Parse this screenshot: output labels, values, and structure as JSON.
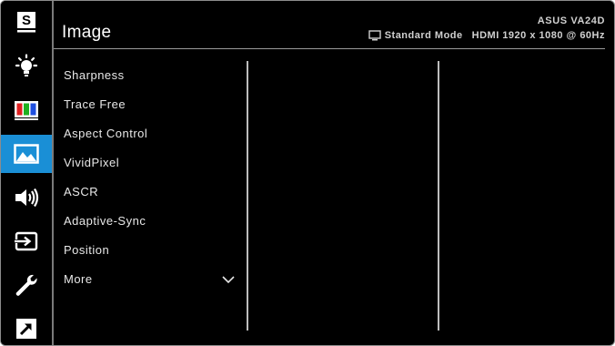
{
  "header": {
    "title": "Image",
    "model": "ASUS VA24D",
    "mode": "Standard Mode",
    "signal": "HDMI 1920 x 1080 @ 60Hz"
  },
  "sidebar": {
    "items": [
      {
        "icon": "splendid-s-icon",
        "active": false
      },
      {
        "icon": "brightness-icon",
        "active": false
      },
      {
        "icon": "color-bars-icon",
        "active": false
      },
      {
        "icon": "image-icon",
        "active": true
      },
      {
        "icon": "sound-icon",
        "active": false
      },
      {
        "icon": "input-select-icon",
        "active": false
      },
      {
        "icon": "wrench-icon",
        "active": false
      },
      {
        "icon": "shortcut-icon",
        "active": false
      }
    ]
  },
  "menu": {
    "items": [
      {
        "label": "Sharpness"
      },
      {
        "label": "Trace Free"
      },
      {
        "label": "Aspect Control"
      },
      {
        "label": "VividPixel"
      },
      {
        "label": "ASCR"
      },
      {
        "label": "Adaptive-Sync"
      },
      {
        "label": "Position"
      },
      {
        "label": "More"
      }
    ]
  },
  "colors": {
    "accent": "#1a8fd6",
    "background": "#000000",
    "text": "#e8e8e8"
  }
}
